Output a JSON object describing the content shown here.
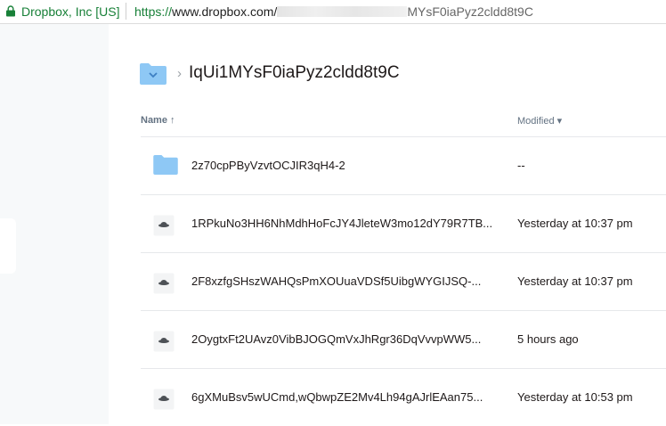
{
  "browser": {
    "org": "Dropbox, Inc [US]",
    "url_proto": "https://",
    "url_host": "www.dropbox.com/",
    "url_tail": "MYsF0iaPyz2cldd8t9C"
  },
  "breadcrumb": {
    "title": "IqUi1MYsF0iaPyz2cldd8t9C"
  },
  "table": {
    "col_name": "Name",
    "col_modified": "Modified",
    "rows": [
      {
        "name": "2z70cpPByVzvtOCJIR3qH4-2",
        "modified": "--",
        "type": "folder"
      },
      {
        "name": "1RPkuNo3HH6NhMdhHoFcJY4JleteW3mo12dY79R7TB...",
        "modified": "Yesterday at 10:37 pm",
        "type": "file"
      },
      {
        "name": "2F8xzfgSHszWAHQsPmXOUuaVDSf5UibgWYGIJSQ-...",
        "modified": "Yesterday at 10:37 pm",
        "type": "file"
      },
      {
        "name": "2OygtxFt2UAvz0VibBJOGQmVxJhRgr36DqVvvpWW5...",
        "modified": "5 hours ago",
        "type": "file"
      },
      {
        "name": "6gXMuBsv5wUCmd,wQbwpZE2Mv4Lh94gAJrlEAan75...",
        "modified": "Yesterday at 10:53 pm",
        "type": "file"
      }
    ]
  },
  "colors": {
    "folder": "#8ec8f5",
    "green": "#188038",
    "text": "#1e1919",
    "muted": "#637282"
  }
}
